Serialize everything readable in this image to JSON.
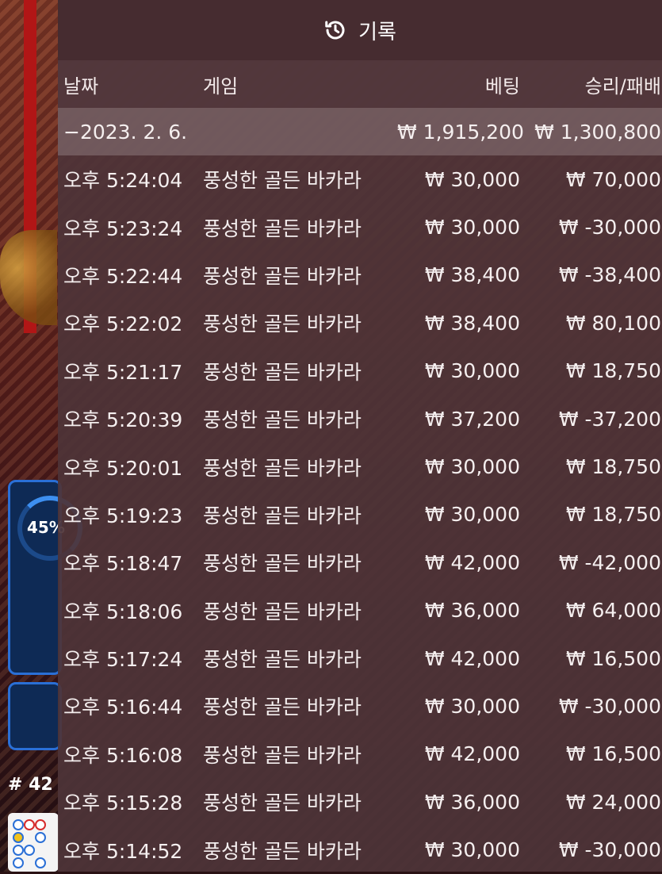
{
  "header": {
    "title": "기록",
    "icon": "history-icon"
  },
  "columns": {
    "date": "날짜",
    "game": "게임",
    "bet": "베팅",
    "winloss": "승리/패배"
  },
  "date_group": {
    "label": "−2023. 2. 6.",
    "bet": "₩ 1,915,200",
    "winloss": "₩ 1,300,800"
  },
  "rows": [
    {
      "time": "오후 5:24:04",
      "game": "풍성한 골든 바카라",
      "bet": "₩ 30,000",
      "winloss": "₩ 70,000"
    },
    {
      "time": "오후 5:23:24",
      "game": "풍성한 골든 바카라",
      "bet": "₩ 30,000",
      "winloss": "₩ -30,000"
    },
    {
      "time": "오후 5:22:44",
      "game": "풍성한 골든 바카라",
      "bet": "₩ 38,400",
      "winloss": "₩ -38,400"
    },
    {
      "time": "오후 5:22:02",
      "game": "풍성한 골든 바카라",
      "bet": "₩ 38,400",
      "winloss": "₩ 80,100"
    },
    {
      "time": "오후 5:21:17",
      "game": "풍성한 골든 바카라",
      "bet": "₩ 30,000",
      "winloss": "₩ 18,750"
    },
    {
      "time": "오후 5:20:39",
      "game": "풍성한 골든 바카라",
      "bet": "₩ 37,200",
      "winloss": "₩ -37,200"
    },
    {
      "time": "오후 5:20:01",
      "game": "풍성한 골든 바카라",
      "bet": "₩ 30,000",
      "winloss": "₩ 18,750"
    },
    {
      "time": "오후 5:19:23",
      "game": "풍성한 골든 바카라",
      "bet": "₩ 30,000",
      "winloss": "₩ 18,750"
    },
    {
      "time": "오후 5:18:47",
      "game": "풍성한 골든 바카라",
      "bet": "₩ 42,000",
      "winloss": "₩ -42,000"
    },
    {
      "time": "오후 5:18:06",
      "game": "풍성한 골든 바카라",
      "bet": "₩ 36,000",
      "winloss": "₩ 64,000"
    },
    {
      "time": "오후 5:17:24",
      "game": "풍성한 골든 바카라",
      "bet": "₩ 42,000",
      "winloss": "₩ 16,500"
    },
    {
      "time": "오후 5:16:44",
      "game": "풍성한 골든 바카라",
      "bet": "₩ 30,000",
      "winloss": "₩ -30,000"
    },
    {
      "time": "오후 5:16:08",
      "game": "풍성한 골든 바카라",
      "bet": "₩ 42,000",
      "winloss": "₩ 16,500"
    },
    {
      "time": "오후 5:15:28",
      "game": "풍성한 골든 바카라",
      "bet": "₩ 36,000",
      "winloss": "₩ 24,000"
    },
    {
      "time": "오후 5:14:52",
      "game": "풍성한 골든 바카라",
      "bet": "₩ 30,000",
      "winloss": "₩ -30,000"
    }
  ],
  "background": {
    "progress_percent": "45%",
    "round_label": "# 42"
  }
}
